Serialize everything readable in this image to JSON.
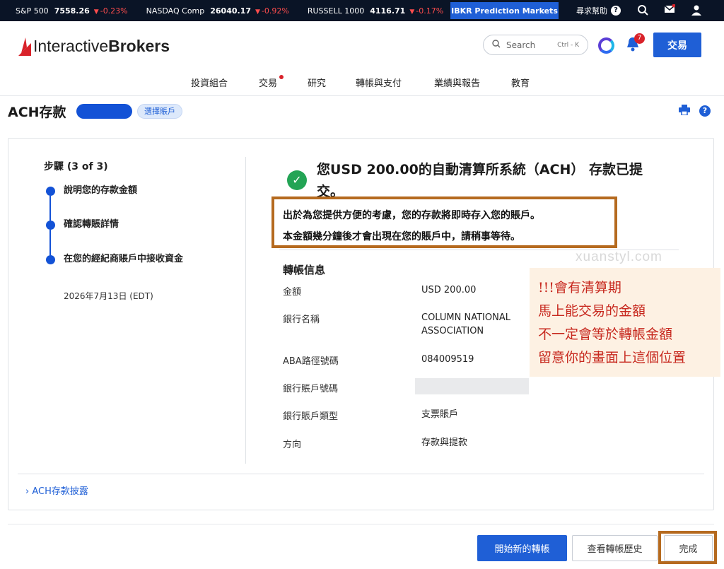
{
  "ticker": {
    "items": [
      {
        "name": "S&P 500",
        "value": "7558.26",
        "change": "-0.23%"
      },
      {
        "name": "NASDAQ Comp",
        "value": "26040.17",
        "change": "-0.92%"
      },
      {
        "name": "RUSSELL 1000",
        "value": "4116.71",
        "change": "-0.17%"
      }
    ],
    "more": "•••",
    "prediction_button": "IBKR Prediction Markets",
    "help_label": "尋求幫助",
    "change_color": "#ff4d4d"
  },
  "header": {
    "logo_light": "Interactive",
    "logo_bold": "Brokers",
    "search_placeholder": "Search",
    "search_shortcut": "Ctrl - K",
    "notification_count": "7",
    "trade_button": "交易",
    "accent": "#1f5fd6",
    "nav": [
      {
        "label": "投資組合"
      },
      {
        "label": "交易"
      },
      {
        "label": "研究"
      },
      {
        "label": "轉帳與支付"
      },
      {
        "label": "業績與報告"
      },
      {
        "label": "教育"
      }
    ]
  },
  "page": {
    "title": "ACH存款",
    "select_account": "選擇賬戶"
  },
  "steps": {
    "title": "步驟 (3 of 3)",
    "items": [
      {
        "label": "說明您的存款金額"
      },
      {
        "label": "確認轉賬詳情"
      },
      {
        "label": "在您的經紀商賬戶中接收資金"
      }
    ],
    "date": "2026年7月13日 (EDT)"
  },
  "confirmation": {
    "message": "您USD 200.00的自動清算所系統（ACH） 存款已提交。",
    "notice_line1": "出於為您提供方便的考慮，您的存款將即時存入您的賬戶。",
    "notice_line2": "本金額幾分鐘後才會出現在您的賬戶中，請稍事等待。",
    "success_color": "#23a455"
  },
  "watermark": "xuanstyl.com",
  "transfer_info": {
    "title": "轉帳信息",
    "rows": [
      {
        "label": "金額",
        "value": "USD 200.00"
      },
      {
        "label": "銀行名稱",
        "value": "COLUMN NATIONAL ASSOCIATION"
      },
      {
        "label": "ABA路徑號碼",
        "value": "084009519"
      },
      {
        "label": "銀行賬戶號碼",
        "value": ""
      },
      {
        "label": "銀行賬戶類型",
        "value": "支票賬戶"
      },
      {
        "label": "方向",
        "value": "存款與提款"
      }
    ]
  },
  "annotation": {
    "lines": [
      "!!!會有清算期",
      "馬上能交易的金額",
      "不一定會等於轉帳金額",
      "留意你的畫面上這個位置"
    ],
    "color": "#c7281e"
  },
  "disclosure": "ACH存款披露",
  "actions": {
    "new_transfer": "開始新的轉帳",
    "view_history": "查看轉帳歷史",
    "done": "完成"
  },
  "highlight_color": "#b56a1f"
}
